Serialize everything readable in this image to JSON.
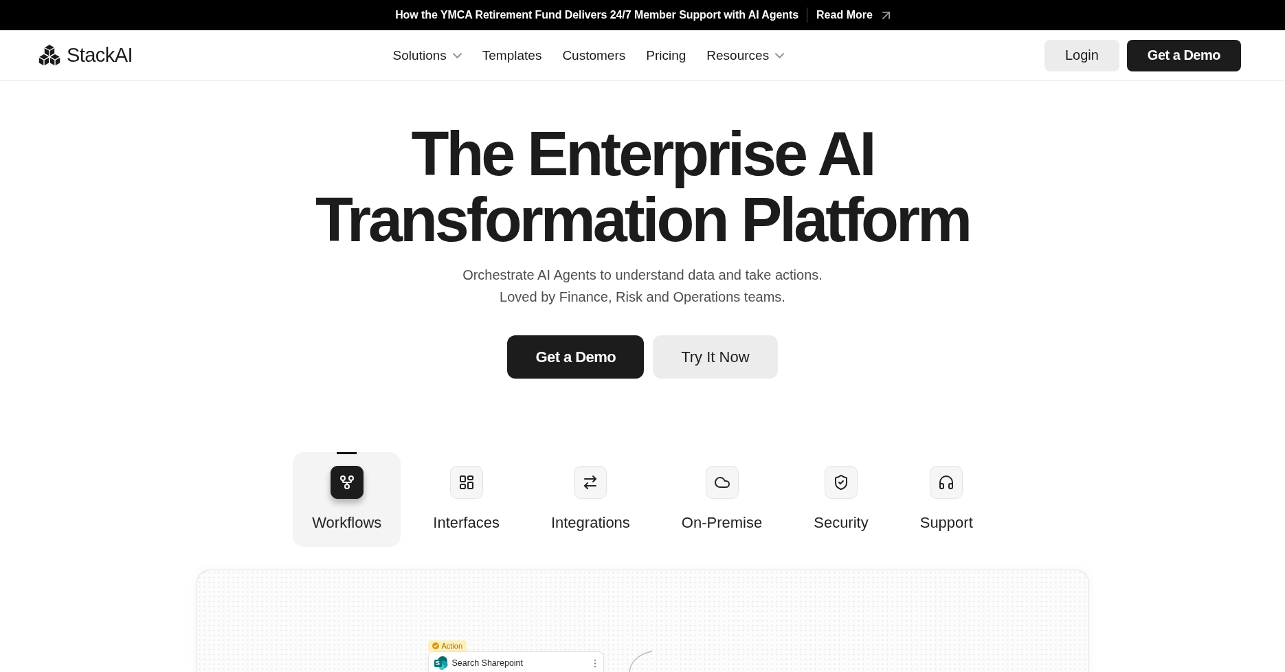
{
  "announcement": {
    "text": "How the YMCA Retirement Fund Delivers 24/7 Member Support with AI Agents",
    "link": "Read More"
  },
  "nav": {
    "logo": "StackAI",
    "links": [
      {
        "label": "Solutions",
        "dropdown": true
      },
      {
        "label": "Templates",
        "dropdown": false
      },
      {
        "label": "Customers",
        "dropdown": false
      },
      {
        "label": "Pricing",
        "dropdown": false
      },
      {
        "label": "Resources",
        "dropdown": true
      }
    ],
    "buttons": [
      {
        "label": "Login",
        "kind": "secondary"
      },
      {
        "label": "Get a Demo",
        "kind": "primary"
      }
    ]
  },
  "hero": {
    "title": "The Enterprise AI Transformation Platform",
    "subtitle": "Orchestrate AI Agents to understand data and take actions.\nLoved by Finance, Risk and Operations teams.",
    "buttons": [
      {
        "label": "Get a Demo",
        "kind": "primary"
      },
      {
        "label": "Try It Now",
        "kind": "secondary"
      }
    ]
  },
  "feature_tabs": [
    {
      "label": "Workflows",
      "selected": true
    },
    {
      "label": "Interfaces",
      "selected": false
    },
    {
      "label": "Integrations",
      "selected": false
    },
    {
      "label": "On-Premise",
      "selected": false
    },
    {
      "label": "Security",
      "selected": false
    },
    {
      "label": "Support",
      "selected": false
    }
  ],
  "canvas": {
    "nodes": [
      {
        "badge": "Action",
        "title": "Search Sharepoint",
        "app_letter": "S"
      }
    ]
  }
}
